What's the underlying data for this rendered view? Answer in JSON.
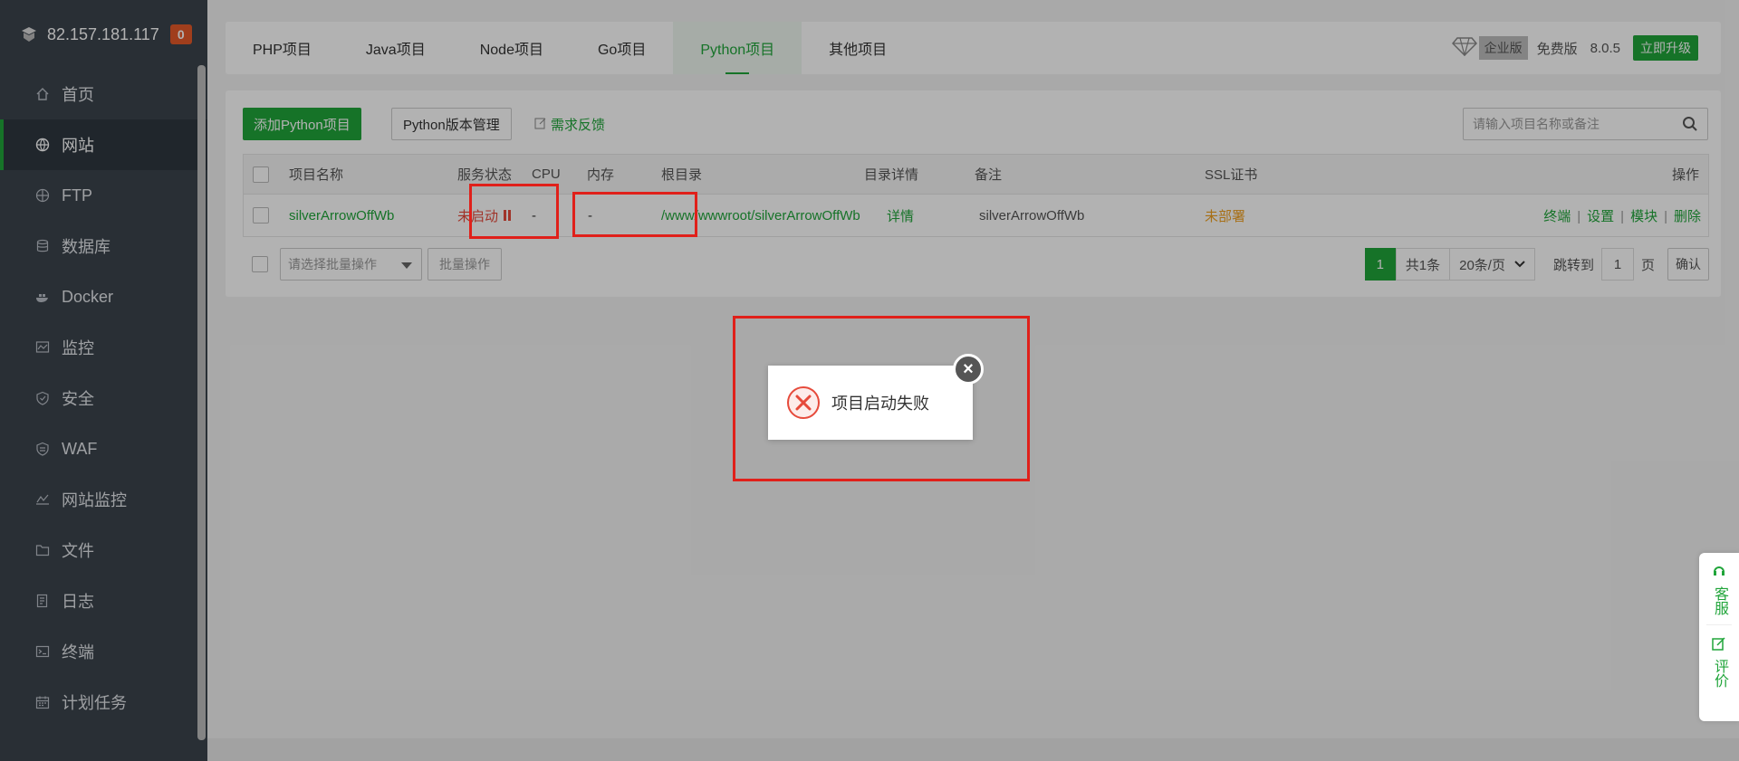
{
  "server": {
    "ip": "82.157.181.117",
    "badge": "0"
  },
  "sidebar": {
    "items": [
      {
        "label": "首页",
        "icon": "home-icon"
      },
      {
        "label": "网站",
        "icon": "globe-icon",
        "active": true
      },
      {
        "label": "FTP",
        "icon": "ftp-icon"
      },
      {
        "label": "数据库",
        "icon": "database-icon"
      },
      {
        "label": "Docker",
        "icon": "docker-icon"
      },
      {
        "label": "监控",
        "icon": "monitor-icon"
      },
      {
        "label": "安全",
        "icon": "shield-icon"
      },
      {
        "label": "WAF",
        "icon": "waf-icon"
      },
      {
        "label": "网站监控",
        "icon": "chart-icon"
      },
      {
        "label": "文件",
        "icon": "folder-icon"
      },
      {
        "label": "日志",
        "icon": "log-icon"
      },
      {
        "label": "终端",
        "icon": "terminal-icon"
      },
      {
        "label": "计划任务",
        "icon": "calendar-icon"
      }
    ]
  },
  "tabs": [
    "PHP项目",
    "Java项目",
    "Node项目",
    "Go项目",
    "Python项目",
    "其他项目"
  ],
  "active_tab": "Python项目",
  "edition": {
    "enterprise": "企业版",
    "free": "免费版",
    "version": "8.0.5",
    "upgrade": "立即升级"
  },
  "toolbar": {
    "add": "添加Python项目",
    "version_mgmt": "Python版本管理",
    "feedback": "需求反馈",
    "search_placeholder": "请输入项目名称或备注"
  },
  "table": {
    "headers": {
      "name": "项目名称",
      "status": "服务状态",
      "cpu": "CPU",
      "mem": "内存",
      "root": "根目录",
      "detail": "目录详情",
      "note": "备注",
      "ssl": "SSL证书",
      "ops": "操作"
    },
    "rows": [
      {
        "name": "silverArrowOffWb",
        "status": "未启动",
        "cpu": "-",
        "mem": "-",
        "root": "/www/wwwroot/silverArrowOffWb",
        "detail": "详情",
        "note": "silverArrowOffWb",
        "ssl": "未部署",
        "ops": [
          "终端",
          "设置",
          "模块",
          "删除"
        ]
      }
    ]
  },
  "batch": {
    "select_placeholder": "请选择批量操作",
    "button": "批量操作"
  },
  "pagination": {
    "current": "1",
    "total": "共1条",
    "per_page": "20条/页",
    "jump_label": "跳转到",
    "jump_value": "1",
    "page_unit": "页",
    "confirm": "确认"
  },
  "toast": {
    "message": "项目启动失败"
  },
  "side_float": {
    "service": "客服",
    "review": "评价"
  },
  "colors": {
    "brand": "#20a53a",
    "sidebar": "#3c444d",
    "error": "#e64a3b",
    "highlight": "#e0201a"
  }
}
